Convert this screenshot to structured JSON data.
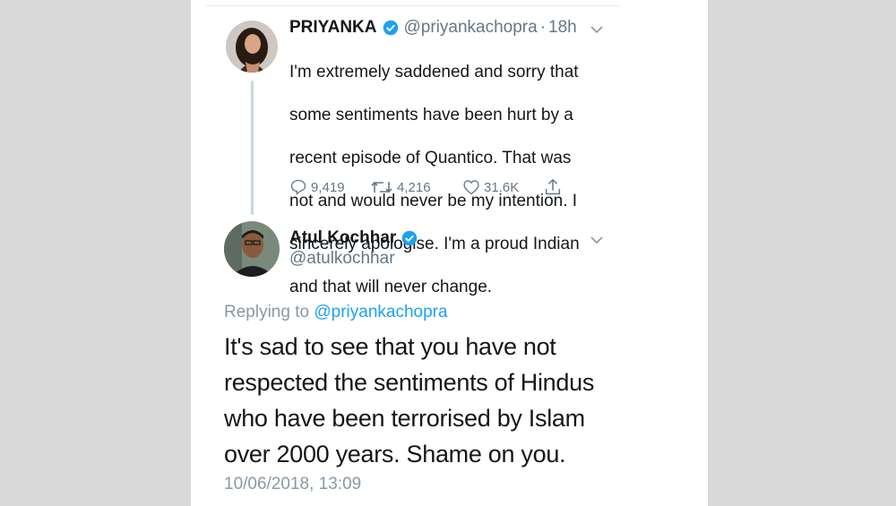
{
  "tweet1": {
    "display_name": "PRIYANKA",
    "handle": "@priyankachopra",
    "separator": "·",
    "time": "18h",
    "text_lines": [
      "I'm extremely saddened and sorry that",
      "some sentiments have been hurt by a",
      "recent episode of Quantico. That was",
      "not and would never be my intention. I",
      "sincerely apologise. I'm a proud Indian",
      "and that will never change."
    ],
    "replies": "9,419",
    "retweets": "4,216",
    "likes": "31.6K"
  },
  "tweet2": {
    "display_name": "Atul Kochhar",
    "handle": "@atulkochhar",
    "replying_prefix": "Replying to",
    "replying_mention": "@priyankachopra",
    "text_lines": [
      "It's sad to see that you have not",
      "respected the sentiments of Hindus",
      "who have been terrorised by Islam",
      "over 2000 years. Shame on you."
    ],
    "timestamp": "10/06/2018, 13:09"
  },
  "colors": {
    "verified": "#1da1f2",
    "mention": "#1da1f2",
    "secondary_text": "#657786",
    "background": "#d9d9d9"
  },
  "icons": {
    "verified": "verified-badge-icon",
    "caret": "chevron-down-icon",
    "reply": "reply-icon",
    "retweet": "retweet-icon",
    "like": "heart-icon",
    "share": "share-icon"
  }
}
